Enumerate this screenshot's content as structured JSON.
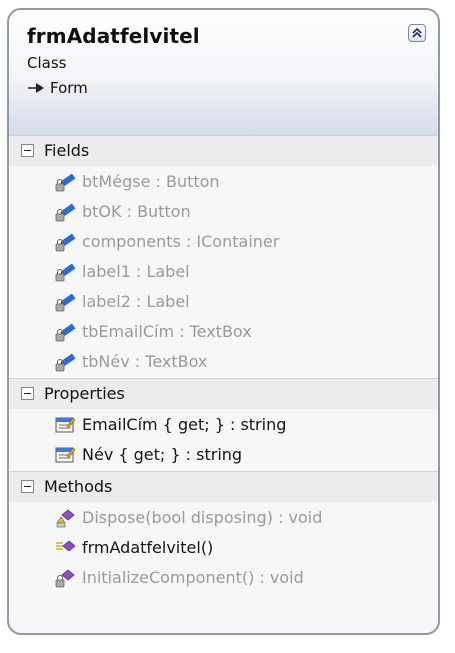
{
  "class_name": "frmAdatfelvitel",
  "stereotype": "Class",
  "base_class": "Form",
  "sections": {
    "fields": {
      "label": "Fields",
      "items": [
        {
          "text": "btMégse : Button",
          "icon": "private-field-icon"
        },
        {
          "text": "btOK : Button",
          "icon": "private-field-icon"
        },
        {
          "text": "components : IContainer",
          "icon": "private-field-icon"
        },
        {
          "text": "label1 : Label",
          "icon": "private-field-icon"
        },
        {
          "text": "label2 : Label",
          "icon": "private-field-icon"
        },
        {
          "text": "tbEmailCím : TextBox",
          "icon": "private-field-icon"
        },
        {
          "text": "tbNév : TextBox",
          "icon": "private-field-icon"
        }
      ]
    },
    "properties": {
      "label": "Properties",
      "items": [
        {
          "text": "EmailCím { get; } : string",
          "icon": "property-icon"
        },
        {
          "text": "Név { get; } : string",
          "icon": "property-icon"
        }
      ]
    },
    "methods": {
      "label": "Methods",
      "items": [
        {
          "text": "Dispose(bool disposing) : void",
          "icon": "protected-method-icon"
        },
        {
          "text": "frmAdatfelvitel()",
          "icon": "public-method-icon"
        },
        {
          "text": "InitializeComponent() : void",
          "icon": "private-method-icon"
        }
      ]
    }
  },
  "colors": {
    "border": "#8d9aa8",
    "muted_text": "#9a9a9a",
    "method_purple": "#8d4fc8",
    "field_blue": "#2f6bd8"
  }
}
